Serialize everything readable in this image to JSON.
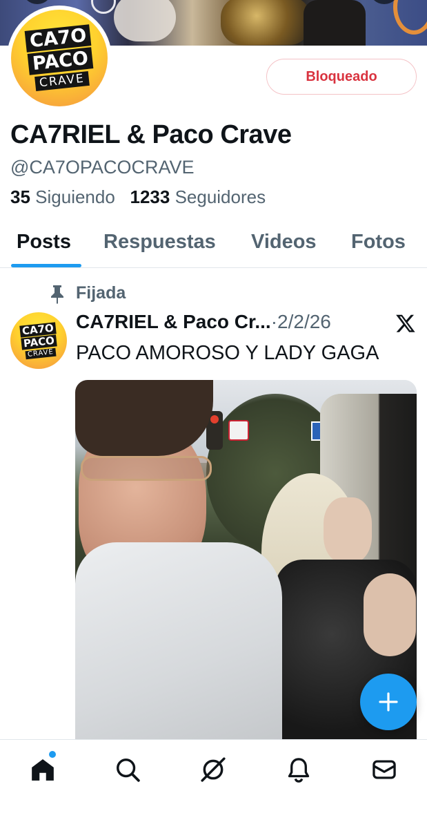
{
  "profile": {
    "name": "CA7RIEL & Paco Crave",
    "handle": "@CA7OPACOCRAVE",
    "following_count": "35",
    "following_label": "Siguiendo",
    "followers_count": "1233",
    "followers_label": "Seguidores",
    "avatar_logo": {
      "line1": "CA7O",
      "line2": "PACO",
      "line3": "CRAVE"
    },
    "block_button_label": "Bloqueado"
  },
  "tabs": [
    {
      "label": "Posts",
      "active": true
    },
    {
      "label": "Respuestas",
      "active": false
    },
    {
      "label": "Videos",
      "active": false
    },
    {
      "label": "Fotos",
      "active": false
    }
  ],
  "post": {
    "pinned_label": "Fijada",
    "author": "CA7RIEL & Paco Cr...",
    "separator": "·",
    "date": "2/2/26",
    "text": "PACO AMOROSO Y LADY GAGA",
    "avatar_logo": {
      "line1": "CA7O",
      "line2": "PACO",
      "line3": "CRAVE"
    }
  },
  "icons": {
    "fab": "plus-icon",
    "nav": [
      "home-icon",
      "search-icon",
      "grok-icon",
      "bell-icon",
      "mail-icon"
    ]
  },
  "colors": {
    "accent": "#1d9bf0",
    "block_red": "#d9333f",
    "secondary_text": "#536471"
  }
}
